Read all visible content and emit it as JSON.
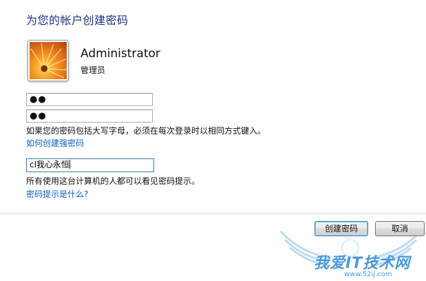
{
  "page": {
    "title": "为您的帐户创建密码"
  },
  "user": {
    "name": "Administrator",
    "role": "管理员"
  },
  "form": {
    "new_password": "●●",
    "confirm_password": "●●",
    "case_note": "如果您的密码包括大写字母，必须在每次登录时以相同方式键入。",
    "strong_password_link": "如何创建强密码",
    "hint_value": "cl我心永恒",
    "hint_note": "所有使用这台计算机的人都可以看见密码提示。",
    "hint_help_link": "密码提示是什么?"
  },
  "buttons": {
    "create": "创建密码",
    "cancel": "取消"
  },
  "watermark": {
    "text": "我爱IT技术网",
    "url": "www.52ij.com"
  },
  "colors": {
    "title": "#1e3287",
    "link": "#0b5fbf",
    "focus_border": "#3c7fb1"
  },
  "icons": {
    "avatar": "orange-flower-user-picture",
    "watermark": "wings-logo"
  }
}
